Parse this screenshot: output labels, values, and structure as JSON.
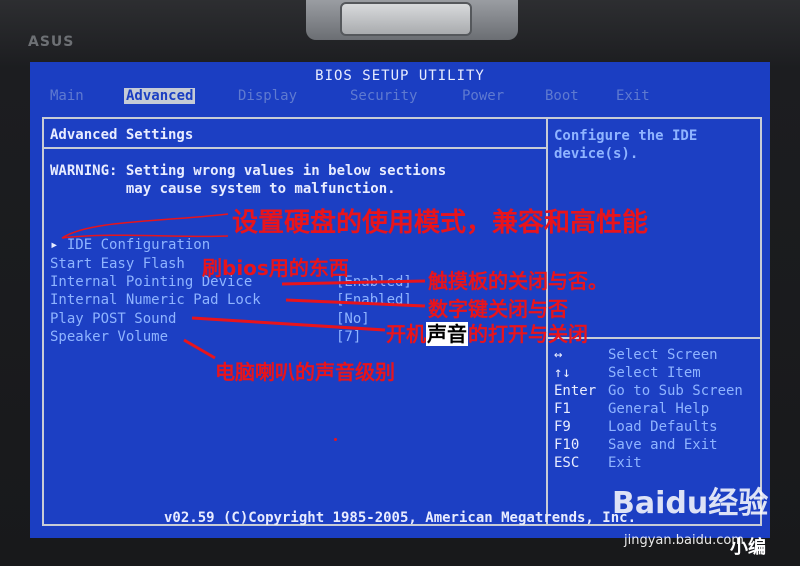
{
  "bezel": {
    "brand": "ASUS"
  },
  "bios": {
    "title": "BIOS SETUP UTILITY",
    "tabs": [
      {
        "label": "Main",
        "active": false
      },
      {
        "label": "Advanced",
        "active": true
      },
      {
        "label": "Display",
        "active": false
      },
      {
        "label": "Security",
        "active": false
      },
      {
        "label": "Power",
        "active": false
      },
      {
        "label": "Boot",
        "active": false
      },
      {
        "label": "Exit",
        "active": false
      }
    ],
    "panel_title": "Advanced Settings",
    "warning_line1": "WARNING: Setting wrong values in below sections",
    "warning_line2": "         may cause system to malfunction.",
    "items": [
      {
        "label": "IDE Configuration",
        "value": "",
        "submenu": true
      },
      {
        "label": "Start Easy Flash",
        "value": ""
      },
      {
        "label": "Internal Pointing Device",
        "value": "[Enabled]"
      },
      {
        "label": "Internal Numeric Pad Lock",
        "value": "[Enabled]"
      },
      {
        "label": "Play POST Sound",
        "value": "[No]"
      },
      {
        "label": "Speaker Volume",
        "value": "[7]"
      }
    ],
    "submenu_arrow": "▸",
    "help_text": "Configure the IDE device(s).",
    "keys": [
      {
        "key": "↔",
        "desc": "Select Screen"
      },
      {
        "key": "↑↓",
        "desc": "Select Item"
      },
      {
        "key": "Enter",
        "desc": "Go to Sub Screen"
      },
      {
        "key": "F1",
        "desc": "General Help"
      },
      {
        "key": "F9",
        "desc": "Load Defaults"
      },
      {
        "key": "F10",
        "desc": "Save and Exit"
      },
      {
        "key": "ESC",
        "desc": "Exit"
      }
    ],
    "footer": "v02.59 (C)Copyright 1985-2005, American Megatrends, Inc."
  },
  "annotations": {
    "ide_mode": "设置硬盘的使用模式，兼容和高性能",
    "flash": "刷bios用的东西",
    "pointing": "触摸板的关闭与否。",
    "numeric": "数字键关闭与否",
    "post_sound_a": "开机",
    "post_sound_b": "声音",
    "post_sound_c": "的打开与关闭",
    "speaker": "电脑喇叭的声音级别",
    "color": "#e8141c"
  },
  "watermark": {
    "logo": "Baidu经验",
    "url": "jingyan.baidu.com",
    "corner": "小编"
  }
}
